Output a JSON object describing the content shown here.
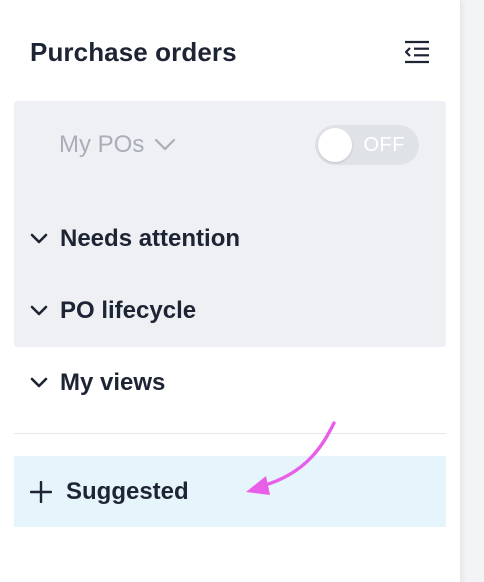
{
  "panel": {
    "title": "Purchase orders",
    "collapse_icon": "collapse-menu-icon"
  },
  "filter": {
    "dropdown_label": "My POs",
    "dropdown_icon": "chevron-down-icon",
    "toggle_state": "OFF"
  },
  "sections": [
    {
      "label": "Needs attention",
      "icon": "chevron-down-icon"
    },
    {
      "label": "PO lifecycle",
      "icon": "chevron-down-icon"
    },
    {
      "label": "My views",
      "icon": "chevron-down-icon"
    }
  ],
  "suggested": {
    "label": "Suggested",
    "icon": "plus-icon"
  },
  "annotation": {
    "arrow_icon": "pointer-arrow-icon",
    "arrow_color": "#e95ee8"
  },
  "colors": {
    "highlight": "#e6f4fc",
    "group_background": "#eef0f4",
    "text": "#1d2433"
  }
}
